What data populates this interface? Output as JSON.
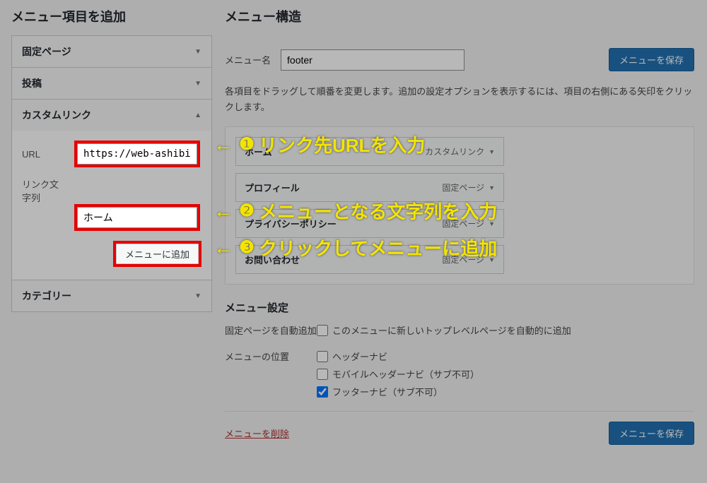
{
  "left": {
    "title": "メニュー項目を追加",
    "acc": {
      "pages": "固定ページ",
      "posts": "投稿",
      "custom": "カスタムリンク",
      "categories": "カテゴリー"
    },
    "custom": {
      "url_label": "URL",
      "url_value": "https://web-ashibi",
      "text_label": "リンク文字列",
      "text_value": "ホーム",
      "add_btn": "メニューに追加"
    }
  },
  "right": {
    "title": "メニュー構造",
    "menu_name_label": "メニュー名",
    "menu_name_value": "footer",
    "save_btn": "メニューを保存",
    "hint": "各項目をドラッグして順番を変更します。追加の設定オプションを表示するには、項目の右側にある矢印をクリックします。",
    "items": [
      {
        "label": "ホーム",
        "type": "カスタムリンク"
      },
      {
        "label": "プロフィール",
        "type": "固定ページ"
      },
      {
        "label": "プライバシーポリシー",
        "type": "固定ページ"
      },
      {
        "label": "お問い合わせ",
        "type": "固定ページ"
      }
    ],
    "settings_title": "メニュー設定",
    "auto_add_label": "固定ページを自動追加",
    "auto_add_desc": "このメニューに新しいトップレベルページを自動的に追加",
    "position_label": "メニューの位置",
    "positions": {
      "header": "ヘッダーナビ",
      "mobile": "モバイルヘッダーナビ（サブ不可）",
      "footer": "フッターナビ（サブ不可）"
    },
    "delete": "メニューを削除"
  },
  "callouts": {
    "c1": "リンク先URLを入力",
    "c2": "メニューとなる文字列を入力",
    "c3": "クリックしてメニューに追加"
  }
}
